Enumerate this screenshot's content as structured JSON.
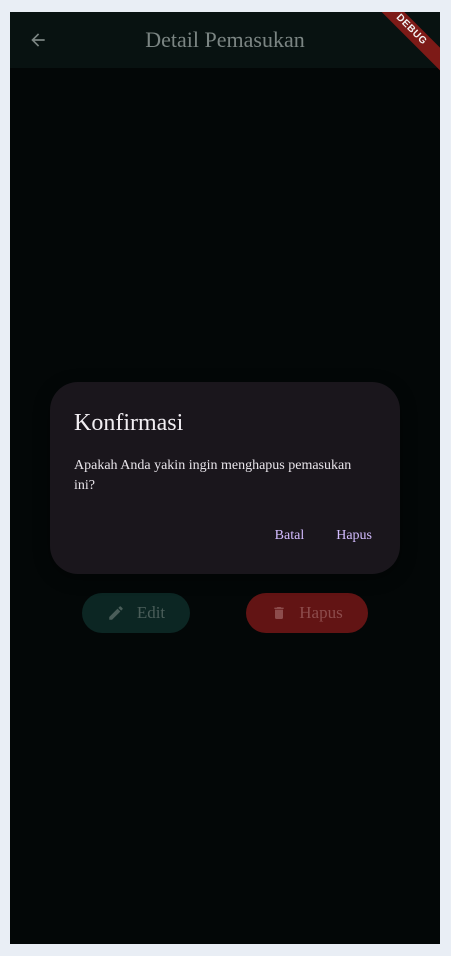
{
  "app_bar": {
    "title": "Detail Pemasukan",
    "back_icon": "arrow-left-icon",
    "debug_banner": "DEBUG"
  },
  "actions": {
    "edit_label": "Edit",
    "edit_icon": "pencil-icon",
    "delete_label": "Hapus",
    "delete_icon": "trash-icon"
  },
  "dialog": {
    "title": "Konfirmasi",
    "message": "Apakah Anda yakin ingin menghapus pemasukan ini?",
    "cancel_label": "Batal",
    "confirm_label": "Hapus"
  },
  "colors": {
    "background": "#030707",
    "app_bar": "#081211",
    "dialog_surface": "#1a161c",
    "dialog_action": "#d3bcff",
    "edit_button": "#0c2623",
    "delete_button": "#621414"
  }
}
